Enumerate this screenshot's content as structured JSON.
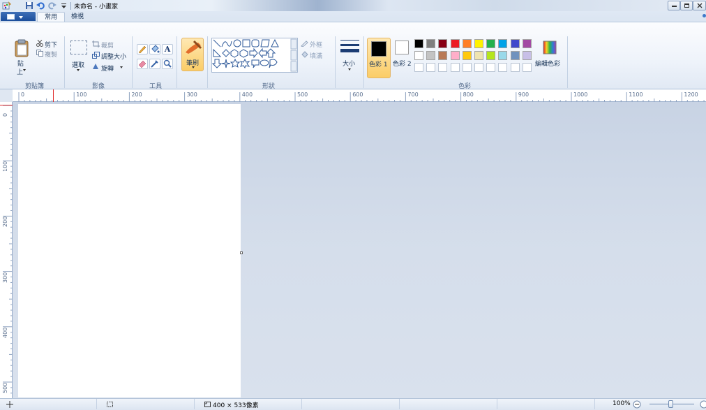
{
  "titlebar": {
    "title": "未命名 - 小畫家"
  },
  "tabs": [
    {
      "label": "常用"
    },
    {
      "label": "檢視"
    }
  ],
  "ribbon": {
    "clipboard": {
      "paste": "貼",
      "paste2": "上",
      "cut": "剪下",
      "copy": "複製",
      "group": "剪貼簿"
    },
    "image": {
      "select": "選取",
      "crop": "裁剪",
      "resize": "調整大小",
      "rotate": "旋轉",
      "group": "影像"
    },
    "tools": {
      "group": "工具",
      "text_tool": "A"
    },
    "brushes": {
      "label": "筆刷"
    },
    "shapes": {
      "outline": "外框",
      "fill": "填滿",
      "group": "形狀"
    },
    "size": {
      "label": "大小"
    },
    "colors": {
      "color1": "色彩 1",
      "color2": "色彩 2",
      "edit": "編輯色彩",
      "group": "色彩",
      "palette_row1": [
        "#000000",
        "#7f7f7f",
        "#880015",
        "#ed1c24",
        "#ff7f27",
        "#fff200",
        "#22b14c",
        "#00a2e8",
        "#3f48cc",
        "#a349a4"
      ],
      "palette_row2": [
        "#ffffff",
        "#c3c3c3",
        "#b97a57",
        "#ffaec9",
        "#ffc90e",
        "#efe4b0",
        "#b5e61d",
        "#99d9ea",
        "#7092be",
        "#c8bfe7"
      ]
    }
  },
  "ruler": {
    "h_marks": [
      "0",
      "100",
      "200",
      "300",
      "400",
      "500",
      "600",
      "700",
      "800",
      "900",
      "1000",
      "1100",
      "1200"
    ],
    "v_marks": [
      "0",
      "100",
      "200",
      "300",
      "400",
      "500"
    ]
  },
  "statusbar": {
    "size_text": "400 × 533像素",
    "zoom": "100%"
  }
}
